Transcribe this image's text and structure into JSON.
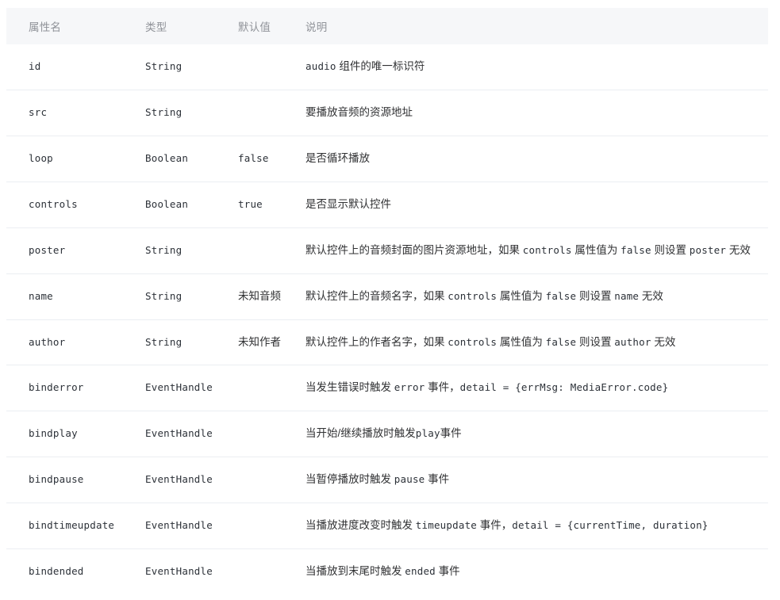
{
  "table": {
    "headers": {
      "name": "属性名",
      "type": "类型",
      "default": "默认值",
      "description": "说明"
    },
    "colors": {
      "header_background": "#f6f7f9",
      "header_text": "#909399",
      "body_text": "#303133",
      "row_border": "#ebeef2",
      "page_background": "#ffffff"
    },
    "rows": [
      {
        "name": "id",
        "type": "String",
        "default": "",
        "description": "audio 组件的唯一标识符",
        "desc_parts": [
          {
            "text": "audio",
            "style": "mono"
          },
          {
            "text": " 组件的唯一标识符",
            "style": "cjk"
          }
        ]
      },
      {
        "name": "src",
        "type": "String",
        "default": "",
        "description": "要播放音频的资源地址",
        "desc_parts": [
          {
            "text": "要播放音频的资源地址",
            "style": "cjk"
          }
        ]
      },
      {
        "name": "loop",
        "type": "Boolean",
        "default": "false",
        "default_style": "mono",
        "description": "是否循环播放",
        "desc_parts": [
          {
            "text": "是否循环播放",
            "style": "cjk"
          }
        ]
      },
      {
        "name": "controls",
        "type": "Boolean",
        "default": "true",
        "default_style": "mono",
        "description": "是否显示默认控件",
        "desc_parts": [
          {
            "text": "是否显示默认控件",
            "style": "cjk"
          }
        ]
      },
      {
        "name": "poster",
        "type": "String",
        "default": "",
        "description": "默认控件上的音频封面的图片资源地址，如果 controls 属性值为 false 则设置 poster 无效",
        "desc_parts": [
          {
            "text": "默认控件上的音频封面的图片资源地址，如果 ",
            "style": "cjk"
          },
          {
            "text": "controls",
            "style": "mono"
          },
          {
            "text": " 属性值为 ",
            "style": "cjk"
          },
          {
            "text": "false",
            "style": "mono"
          },
          {
            "text": " 则设置 ",
            "style": "cjk"
          },
          {
            "text": "poster",
            "style": "mono"
          },
          {
            "text": " 无效",
            "style": "cjk"
          }
        ]
      },
      {
        "name": "name",
        "type": "String",
        "default": "未知音频",
        "default_style": "cjk",
        "description": "默认控件上的音频名字，如果 controls 属性值为 false 则设置 name 无效",
        "desc_parts": [
          {
            "text": "默认控件上的音频名字，如果 ",
            "style": "cjk"
          },
          {
            "text": "controls",
            "style": "mono"
          },
          {
            "text": " 属性值为 ",
            "style": "cjk"
          },
          {
            "text": "false",
            "style": "mono"
          },
          {
            "text": " 则设置 ",
            "style": "cjk"
          },
          {
            "text": "name",
            "style": "mono"
          },
          {
            "text": " 无效",
            "style": "cjk"
          }
        ]
      },
      {
        "name": "author",
        "type": "String",
        "default": "未知作者",
        "default_style": "cjk",
        "description": "默认控件上的作者名字，如果 controls 属性值为 false 则设置 author 无效",
        "desc_parts": [
          {
            "text": "默认控件上的作者名字，如果 ",
            "style": "cjk"
          },
          {
            "text": "controls",
            "style": "mono"
          },
          {
            "text": " 属性值为 ",
            "style": "cjk"
          },
          {
            "text": "false",
            "style": "mono"
          },
          {
            "text": " 则设置 ",
            "style": "cjk"
          },
          {
            "text": "author",
            "style": "mono"
          },
          {
            "text": " 无效",
            "style": "cjk"
          }
        ]
      },
      {
        "name": "binderror",
        "type": "EventHandle",
        "default": "",
        "description": "当发生错误时触发 error 事件，detail = {errMsg: MediaError.code}",
        "desc_parts": [
          {
            "text": "当发生错误时触发 ",
            "style": "cjk"
          },
          {
            "text": "error",
            "style": "mono"
          },
          {
            "text": " 事件，",
            "style": "cjk"
          },
          {
            "text": "detail = {errMsg: MediaError.code}",
            "style": "mono"
          }
        ]
      },
      {
        "name": "bindplay",
        "type": "EventHandle",
        "default": "",
        "description": "当开始/继续播放时触发play事件",
        "desc_parts": [
          {
            "text": "当开始/继续播放时触发",
            "style": "cjk"
          },
          {
            "text": "play",
            "style": "mono"
          },
          {
            "text": "事件",
            "style": "cjk"
          }
        ]
      },
      {
        "name": "bindpause",
        "type": "EventHandle",
        "default": "",
        "description": "当暂停播放时触发 pause 事件",
        "desc_parts": [
          {
            "text": "当暂停播放时触发 ",
            "style": "cjk"
          },
          {
            "text": "pause",
            "style": "mono"
          },
          {
            "text": " 事件",
            "style": "cjk"
          }
        ]
      },
      {
        "name": "bindtimeupdate",
        "type": "EventHandle",
        "default": "",
        "description": "当播放进度改变时触发 timeupdate 事件，detail = {currentTime, duration}",
        "desc_parts": [
          {
            "text": "当播放进度改变时触发 ",
            "style": "cjk"
          },
          {
            "text": "timeupdate",
            "style": "mono"
          },
          {
            "text": " 事件，",
            "style": "cjk"
          },
          {
            "text": "detail = {currentTime, duration}",
            "style": "mono"
          }
        ]
      },
      {
        "name": "bindended",
        "type": "EventHandle",
        "default": "",
        "description": "当播放到末尾时触发 ended 事件",
        "desc_parts": [
          {
            "text": "当播放到末尾时触发 ",
            "style": "cjk"
          },
          {
            "text": "ended",
            "style": "mono"
          },
          {
            "text": " 事件",
            "style": "cjk"
          }
        ]
      }
    ]
  }
}
